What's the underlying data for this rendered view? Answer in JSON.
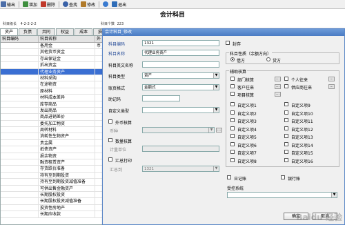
{
  "toolbar": {
    "items": [
      {
        "label": "输出",
        "icon": "print-icon",
        "color": "#4c6ea8"
      },
      {
        "label": "增加",
        "icon": "add-icon",
        "color": "#3f8f3f"
      },
      {
        "label": "删除",
        "icon": "delete-icon",
        "color": "#c0392b"
      },
      {
        "label": "查找",
        "icon": "find-icon",
        "color": "#3a62a8"
      },
      {
        "label": "修改",
        "icon": "edit-icon",
        "color": "#b07a2a"
      },
      {
        "label": "退出",
        "icon": "exit-icon",
        "color": "#3a7bd0"
      }
    ],
    "help_icon": "help-icon"
  },
  "page": {
    "title": "会计科目",
    "code_length_label": "科目级长",
    "code_length_value": "4-2-2-2-2",
    "count_label": "科目个数",
    "count_value": "223"
  },
  "tabs": [
    "资产",
    "负债",
    "共同",
    "权益",
    "成本",
    "损益"
  ],
  "grid": {
    "headers": [
      "科目编码",
      "科目名称",
      "外币"
    ],
    "selected_index": 4,
    "rows": [
      {
        "code": "",
        "name": "备用金"
      },
      {
        "code": "",
        "name": "其他货币资金"
      },
      {
        "code": "",
        "name": "存出保证金"
      },
      {
        "code": "",
        "name": "拆出资金"
      },
      {
        "code": "",
        "name": "代理业务资产"
      },
      {
        "code": "",
        "name": "材料采购"
      },
      {
        "code": "",
        "name": "在途物资"
      },
      {
        "code": "",
        "name": "原材料"
      },
      {
        "code": "",
        "name": "材料成本差异"
      },
      {
        "code": "",
        "name": "库存商品"
      },
      {
        "code": "",
        "name": "发出商品"
      },
      {
        "code": "",
        "name": "商品进销差价"
      },
      {
        "code": "",
        "name": "委托加工物资"
      },
      {
        "code": "",
        "name": "周转材料"
      },
      {
        "code": "",
        "name": "消耗性生物资产"
      },
      {
        "code": "",
        "name": "贵金属"
      },
      {
        "code": "",
        "name": "抵债资产"
      },
      {
        "code": "",
        "name": "损余物资"
      },
      {
        "code": "",
        "name": "融资租赁资产"
      },
      {
        "code": "",
        "name": "存货跌价准备"
      },
      {
        "code": "",
        "name": "持有至到期投资"
      },
      {
        "code": "",
        "name": "持有至到期投资减值准备"
      },
      {
        "code": "",
        "name": "可供出售金融资产"
      },
      {
        "code": "",
        "name": "长期股权投资"
      },
      {
        "code": "",
        "name": "长期股权投资减值准备"
      },
      {
        "code": "",
        "name": "投资性房地产"
      },
      {
        "code": "",
        "name": "长期应收款"
      }
    ]
  },
  "dialog": {
    "title": "会计科目_修改",
    "fields": {
      "code_label": "科目编码",
      "code_value": "1321",
      "name_label": "科目名称",
      "name_value": "代理业务资产",
      "en_name_label": "科目英文名称",
      "en_name_value": "",
      "type_label": "科目类型",
      "type_value": "资产",
      "format_label": "账页格式",
      "format_value": "金额式",
      "mnemonic_label": "助记码",
      "mnemonic_value": "",
      "custom_type_label": "自定义类型",
      "custom_type_value": "",
      "foreign_label": "外币核算",
      "currency_label": "币种",
      "currency_value": "",
      "quantity_label": "数量核算",
      "unit_label": "计量单位",
      "unit_value": "",
      "summary_print_label": "汇总打印",
      "summary_to_label": "汇总到",
      "summary_to_value": "1321"
    },
    "sealed_label": "封存",
    "nature": {
      "title": "科目性质（余额方向）",
      "debit": "借方",
      "credit": "贷方",
      "selected": "借方"
    },
    "aux": {
      "title": "辅助核算",
      "items": [
        "部门核算",
        "个人往来",
        "客户往来",
        "供应商往来",
        "项目核算"
      ],
      "custom": [
        "自定义项1",
        "自定义项2",
        "自定义项3",
        "自定义项4",
        "自定义项5",
        "自定义项6",
        "自定义项7",
        "自定义项8",
        "自定义项9",
        "自定义项10",
        "自定义项11",
        "自定义项12",
        "自定义项13",
        "自定义项14",
        "自定义项15",
        "自定义项16"
      ]
    },
    "journal_label": "日记账",
    "bank_label": "银行账",
    "controlled_label": "受控系统",
    "controlled_value": "",
    "ok_label": "确定",
    "cancel_label": "取消"
  },
  "watermark": "Baidu 经验"
}
